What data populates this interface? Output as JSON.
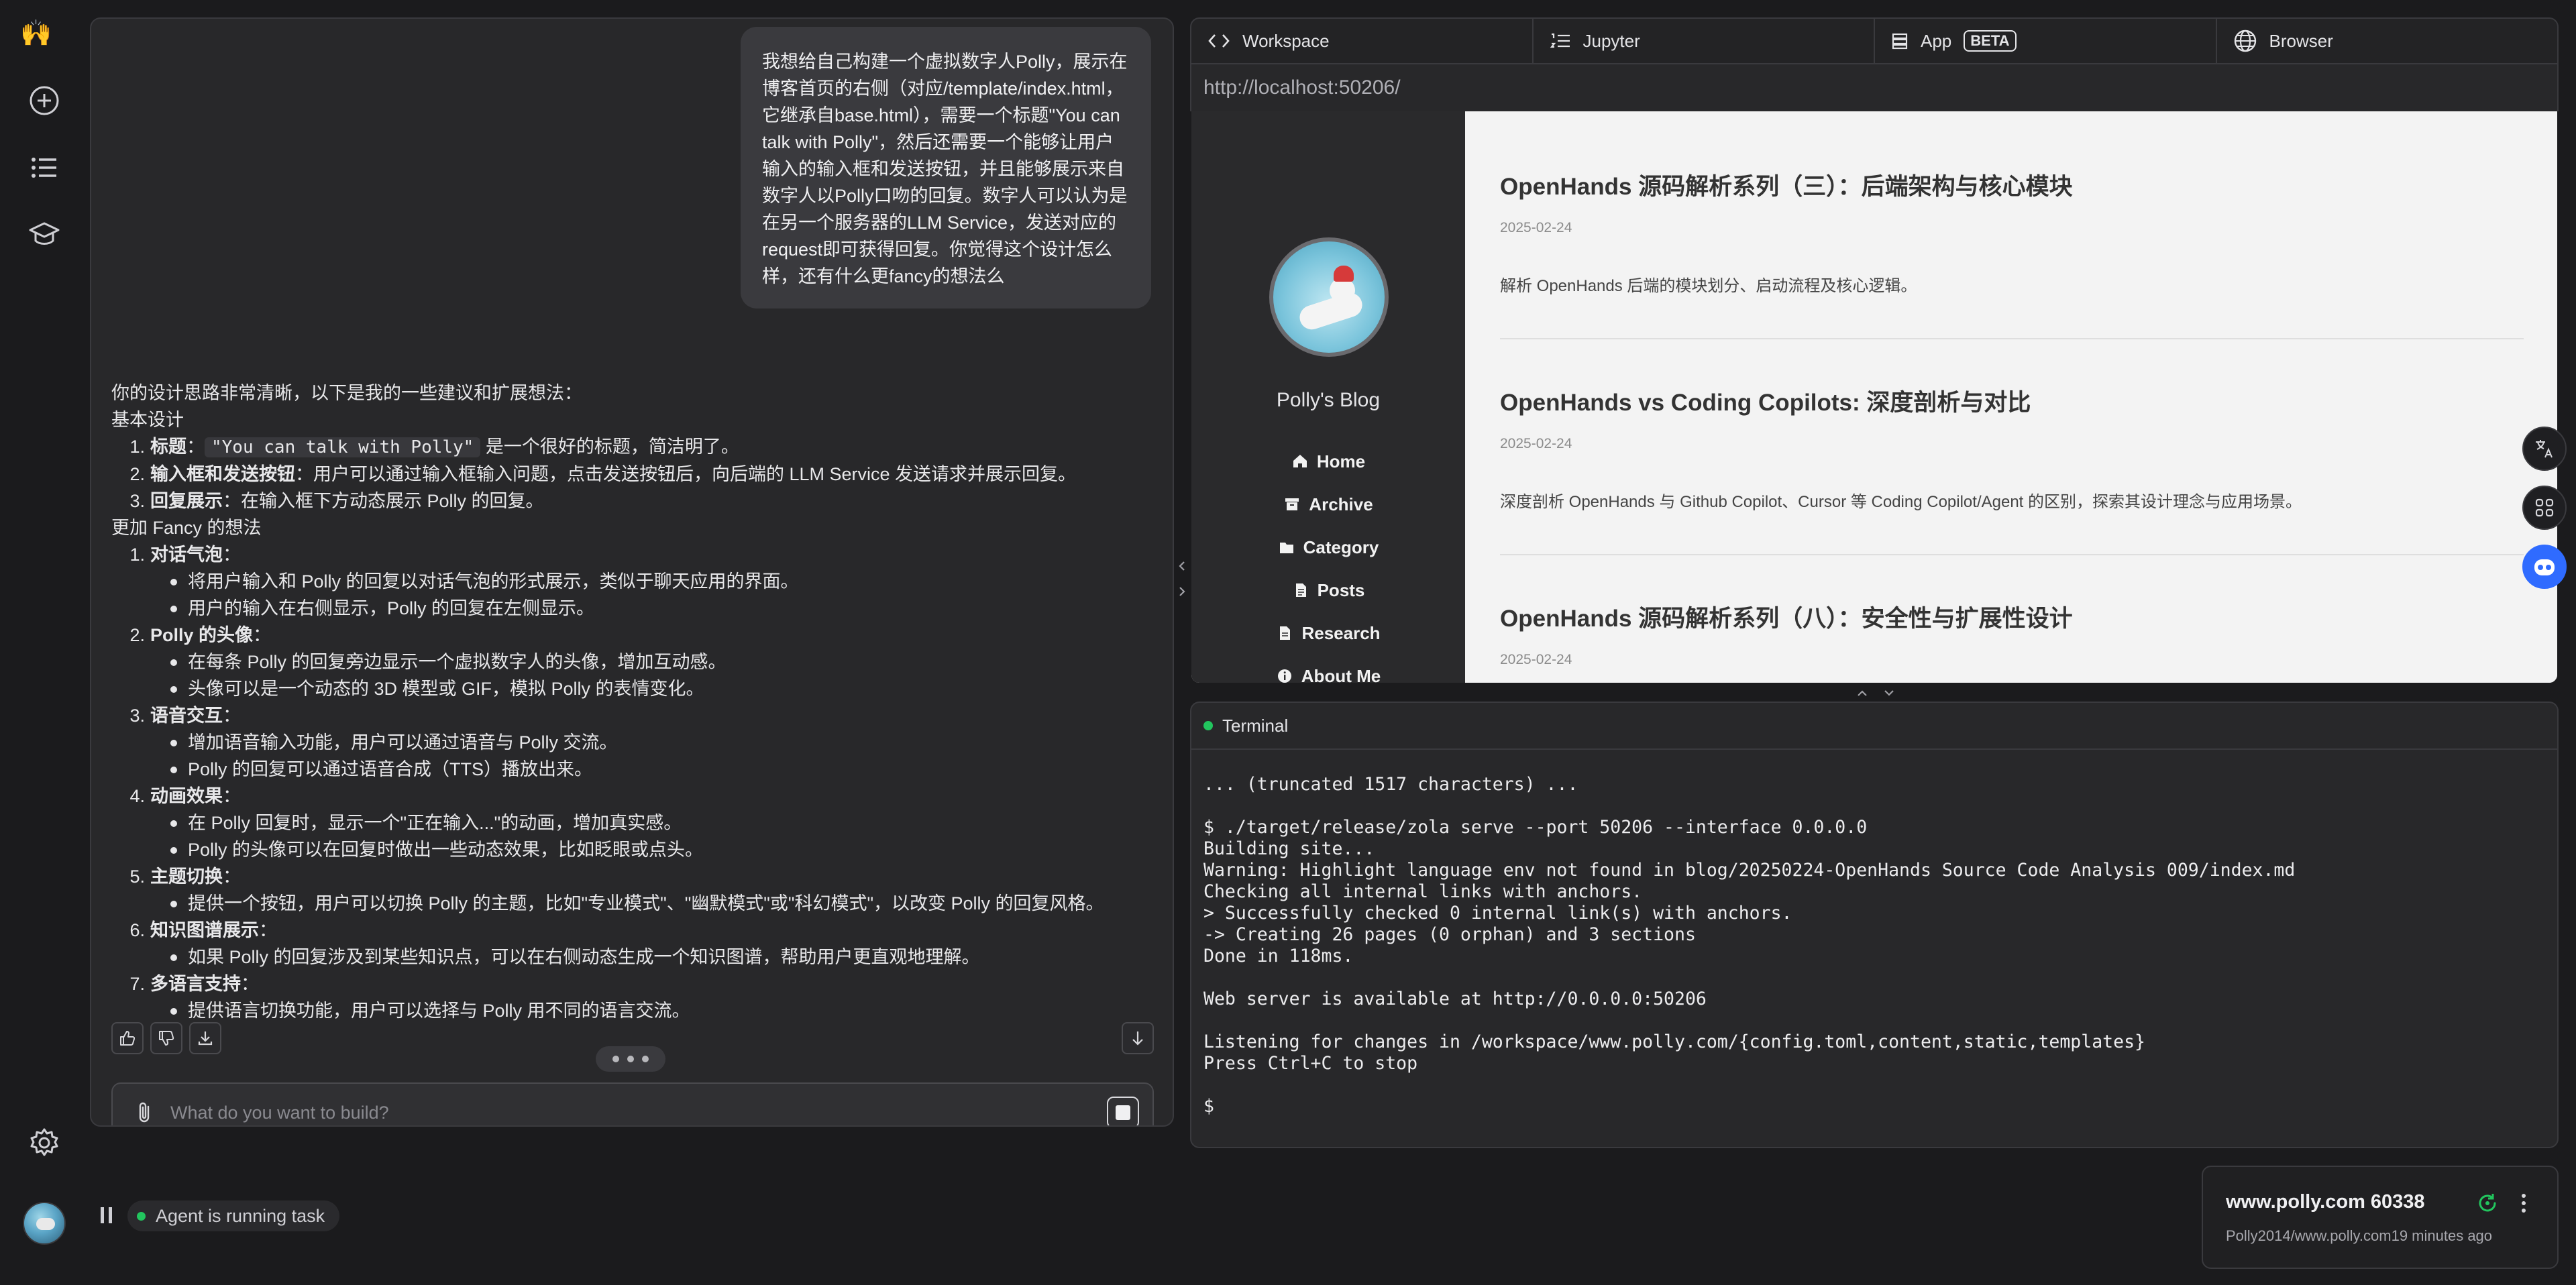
{
  "chat": {
    "user_message": "我想给自己构建一个虚拟数字人Polly，展示在博客首页的右侧（对应/template/index.html，它继承自base.html），需要一个标题\"You can talk with Polly\"，然后还需要一个能够让用户输入的输入框和发送按钮，并且能够展示来自数字人以Polly口吻的回复。数字人可以认为是在另一个服务器的LLM Service，发送对应的request即可获得回复。你觉得这个设计怎么样，还有什么更fancy的想法么",
    "intro": "你的设计思路非常清晰，以下是我的一些建议和扩展想法：",
    "basic_heading": "基本设计",
    "basic_items": [
      {
        "num": "1.",
        "title": "标题",
        "sep": "：",
        "code": "\"You can talk with Polly\"",
        "text": " 是一个很好的标题，简洁明了。"
      },
      {
        "num": "2.",
        "title": "输入框和发送按钮",
        "sep": "：",
        "code": "",
        "text": "用户可以通过输入框输入问题，点击发送按钮后，向后端的 LLM Service 发送请求并展示回复。"
      },
      {
        "num": "3.",
        "title": "回复展示",
        "sep": "：",
        "code": "",
        "text": "在输入框下方动态展示 Polly 的回复。"
      }
    ],
    "fancy_heading": "更加 Fancy 的想法",
    "fancy_items": [
      {
        "num": "1.",
        "title": "对话气泡",
        "bullets": [
          "将用户输入和 Polly 的回复以对话气泡的形式展示，类似于聊天应用的界面。",
          "用户的输入在右侧显示，Polly 的回复在左侧显示。"
        ]
      },
      {
        "num": "2.",
        "title": "Polly 的头像",
        "bullets": [
          "在每条 Polly 的回复旁边显示一个虚拟数字人的头像，增加互动感。",
          "头像可以是一个动态的 3D 模型或 GIF，模拟 Polly 的表情变化。"
        ]
      },
      {
        "num": "3.",
        "title": "语音交互",
        "bullets": [
          "增加语音输入功能，用户可以通过语音与 Polly 交流。",
          "Polly 的回复可以通过语音合成（TTS）播放出来。"
        ]
      },
      {
        "num": "4.",
        "title": "动画效果",
        "bullets": [
          "在 Polly 回复时，显示一个\"正在输入...\"的动画，增加真实感。",
          "Polly 的头像可以在回复时做出一些动态效果，比如眨眼或点头。"
        ]
      },
      {
        "num": "5.",
        "title": "主题切换",
        "bullets": [
          "提供一个按钮，用户可以切换 Polly 的主题，比如\"专业模式\"、\"幽默模式\"或\"科幻模式\"，以改变 Polly 的回复风格。"
        ]
      },
      {
        "num": "6.",
        "title": "知识图谱展示",
        "bullets": [
          "如果 Polly 的回复涉及到某些知识点，可以在右侧动态生成一个知识图谱，帮助用户更直观地理解。"
        ]
      },
      {
        "num": "7.",
        "title": "多语言支持",
        "bullets": [
          "提供语言切换功能，用户可以选择与 Polly 用不同的语言交流。"
        ]
      }
    ],
    "input_placeholder": "What do you want to build?",
    "agent_status": "Agent is running task"
  },
  "tabs": [
    {
      "label": "Workspace",
      "icon": "code-icon",
      "badge": ""
    },
    {
      "label": "Jupyter",
      "icon": "list-icon",
      "badge": ""
    },
    {
      "label": "App",
      "icon": "server-icon",
      "badge": "BETA"
    },
    {
      "label": "Browser",
      "icon": "globe-icon",
      "badge": ""
    }
  ],
  "browser": {
    "url": "http://localhost:50206/",
    "blog_name": "Polly's Blog",
    "nav": [
      {
        "label": "Home",
        "icon": "home-icon"
      },
      {
        "label": "Archive",
        "icon": "archive-icon"
      },
      {
        "label": "Category",
        "icon": "folder-icon"
      },
      {
        "label": "Posts",
        "icon": "file-icon"
      },
      {
        "label": "Research",
        "icon": "document-icon"
      },
      {
        "label": "About Me",
        "icon": "info-icon"
      }
    ],
    "posts": [
      {
        "title": "OpenHands 源码解析系列（三）：后端架构与核心模块",
        "date": "2025-02-24",
        "desc": "解析 OpenHands 后端的模块划分、启动流程及核心逻辑。"
      },
      {
        "title": "OpenHands vs Coding Copilots: 深度剖析与对比",
        "date": "2025-02-24",
        "desc": "深度剖析 OpenHands 与 Github Copilot、Cursor 等 Coding Copilot/Agent 的区别，探索其设计理念与应用场景。"
      },
      {
        "title": "OpenHands 源码解析系列（八）：安全性与扩展性设计",
        "date": "2025-02-24",
        "desc": ""
      }
    ]
  },
  "terminal": {
    "title": "Terminal",
    "output": "... (truncated 1517 characters) ...\n\n$ ./target/release/zola serve --port 50206 --interface 0.0.0.0\nBuilding site...\nWarning: Highlight language env not found in blog/20250224-OpenHands Source Code Analysis 009/index.md\nChecking all internal links with anchors.\n> Successfully checked 0 internal link(s) with anchors.\n-> Creating 26 pages (0 orphan) and 3 sections\nDone in 118ms.\n\nWeb server is available at http://0.0.0.0:50206\n\nListening for changes in /workspace/www.polly.com/{config.toml,content,static,templates}\nPress Ctrl+C to stop\n\n$"
  },
  "workspace": {
    "title": "www.polly.com 60338",
    "subtitle": "Polly2014/www.polly.com19 minutes ago"
  },
  "colors": {
    "status_green": "#22c55e",
    "accent_blue": "#2f6bff"
  }
}
